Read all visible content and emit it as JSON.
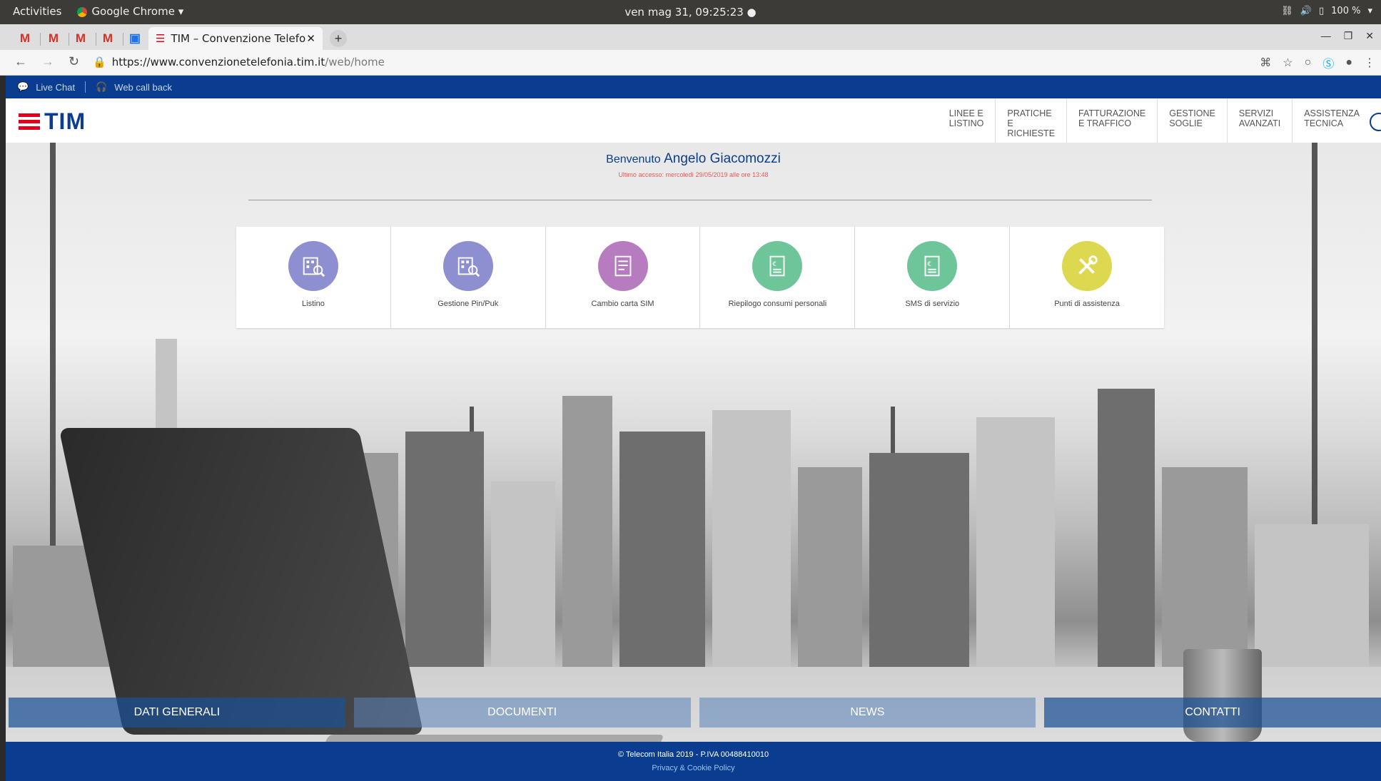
{
  "os": {
    "activities": "Activities",
    "app_name": "Google Chrome ▾",
    "clock": "ven mag 31, 09:25:23 ●",
    "battery": "100 %"
  },
  "browser": {
    "pinned_tabs": [
      "M",
      "M",
      "M",
      "M"
    ],
    "active_tab_title": "TIM – Convenzione Telefo",
    "url_host": "https://www.convenzionetelefonia.tim.it",
    "url_path": "/web/home"
  },
  "site": {
    "util": {
      "live_chat": "Live Chat",
      "web_call_back": "Web call back"
    },
    "logo_text": "TIM",
    "nav": [
      "LINEE E\nLISTINO",
      "PRATICHE\nE\nRICHIESTE",
      "FATTURAZIONE\nE TRAFFICO",
      "GESTIONE\nSOGLIE",
      "SERVIZI\nAVANZATI",
      "ASSISTENZA\nTECNICA"
    ],
    "welcome": {
      "prefix": "Benvenuto",
      "name": "Angelo Giacomozzi",
      "last_access": "Ultimo accesso: mercoledì 29/05/2019 alle ore 13:48"
    },
    "tiles": [
      {
        "label": "Listino",
        "color": "#8e8fd0"
      },
      {
        "label": "Gestione Pin/Puk",
        "color": "#8e8fd0"
      },
      {
        "label": "Cambio carta SIM",
        "color": "#b77cc0"
      },
      {
        "label": "Riepilogo consumi personali",
        "color": "#6fc59a"
      },
      {
        "label": "SMS di servizio",
        "color": "#6fc59a"
      },
      {
        "label": "Punti di assistenza",
        "color": "#dcd850"
      }
    ],
    "bottom_tabs": [
      "DATI GENERALI",
      "DOCUMENTI",
      "NEWS",
      "CONTATTI"
    ],
    "footer": {
      "copyright": "© Telecom Italia 2019 - P.IVA 00488410010",
      "privacy": "Privacy & Cookie Policy"
    }
  }
}
